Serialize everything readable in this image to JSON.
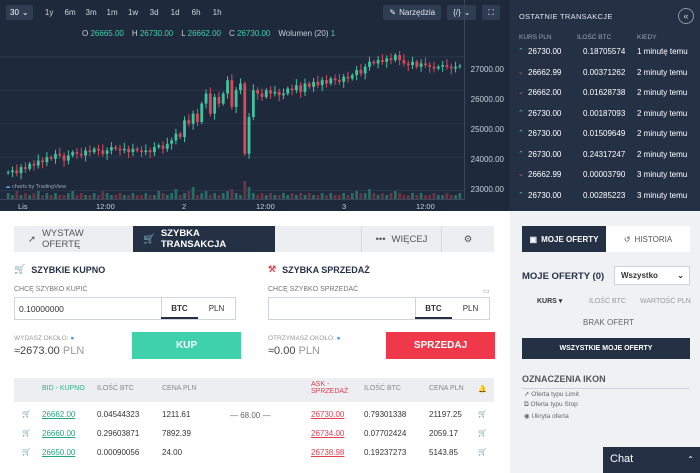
{
  "chart": {
    "interval": "30",
    "timeframes": [
      "1y",
      "6m",
      "3m",
      "1m",
      "1w",
      "3d",
      "1d",
      "6h",
      "1h"
    ],
    "tools_label": "Narzędzia",
    "ohlc": {
      "o_label": "O",
      "o": "26665.00",
      "h_label": "H",
      "h": "26730.00",
      "l_label": "L",
      "l": "26662.00",
      "c_label": "C",
      "c": "26730.00",
      "volume": "Wolumen (20)",
      "volume_value": "1"
    },
    "logo_text": "charts by TradingView"
  },
  "chart_data": {
    "type": "candlestick",
    "y_ticks": [
      "27000.00",
      "26000.00",
      "25000.00",
      "24000.00",
      "23000.00"
    ],
    "y_tick_values": [
      27000,
      26000,
      25000,
      24000,
      23000
    ],
    "x_ticks": [
      "Lis",
      "12:00",
      "2",
      "12:00",
      "3",
      "12:00"
    ],
    "ylim": [
      22750,
      27350
    ],
    "close": [
      23550,
      23600,
      23520,
      23700,
      23650,
      23800,
      23750,
      23900,
      23850,
      24000,
      23950,
      24100,
      24050,
      23900,
      24050,
      24150,
      24100,
      24050,
      24200,
      24150,
      24250,
      24200,
      24100,
      24200,
      24300,
      24250,
      24200,
      24250,
      24150,
      24250,
      24200,
      24150,
      24200,
      24150,
      24300,
      24350,
      24250,
      24400,
      24500,
      24700,
      24600,
      25100,
      25000,
      25300,
      25050,
      25600,
      25900,
      25300,
      25800,
      25600,
      25900,
      26300,
      25500,
      26000,
      26200,
      24100,
      25200,
      26000,
      25900,
      25800,
      26000,
      25900,
      25950,
      25850,
      25900,
      26050,
      26000,
      26150,
      25950,
      26200,
      26100,
      26250,
      26150,
      26300,
      26200,
      26350,
      26300,
      26250,
      26400,
      26350,
      26450,
      26600,
      26500,
      26700,
      26850,
      26800,
      26900,
      26850,
      26950,
      26900,
      27050,
      26900,
      26800,
      26750,
      26850,
      26700,
      26800,
      26750,
      26700,
      26650,
      26700,
      26750,
      26700,
      26650,
      26700,
      26730
    ],
    "volume": [
      3,
      2,
      4,
      2,
      3,
      2,
      3,
      4,
      2,
      3,
      2,
      3,
      2,
      2,
      3,
      4,
      2,
      3,
      2,
      2,
      3,
      2,
      4,
      3,
      2,
      2,
      3,
      2,
      2,
      3,
      2,
      2,
      3,
      2,
      2,
      4,
      3,
      2,
      3,
      5,
      2,
      3,
      4,
      6,
      2,
      3,
      4,
      2,
      3,
      2,
      3,
      4,
      5,
      3,
      2,
      9,
      6,
      3,
      2,
      3,
      2,
      3,
      2,
      2,
      3,
      2,
      3,
      2,
      3,
      2,
      3,
      2,
      2,
      3,
      2,
      3,
      2,
      2,
      3,
      2,
      3,
      4,
      3,
      3,
      5,
      3,
      2,
      3,
      2,
      3,
      4,
      3,
      2,
      2,
      3,
      2,
      3,
      2,
      2,
      3,
      2,
      2,
      3,
      2,
      2,
      3
    ]
  },
  "recent": {
    "title": "OSTATNIE TRANSAKCJE",
    "headers": [
      "KURS PLN",
      "ILOŚĆ BTC",
      "KIEDY"
    ],
    "rows": [
      {
        "dir": "up",
        "price": "26730.00",
        "qty": "0.18705574",
        "when": "1 minutę temu"
      },
      {
        "dir": "dn",
        "price": "26662.99",
        "qty": "0.00371262",
        "when": "2 minuty temu"
      },
      {
        "dir": "dn",
        "price": "26662.00",
        "qty": "0.01628738",
        "when": "2 minuty temu"
      },
      {
        "dir": "up",
        "price": "26730.00",
        "qty": "0.00187093",
        "when": "2 minuty temu"
      },
      {
        "dir": "up",
        "price": "26730.00",
        "qty": "0.01509649",
        "when": "2 minuty temu"
      },
      {
        "dir": "up",
        "price": "26730.00",
        "qty": "0.24317247",
        "when": "2 minuty temu"
      },
      {
        "dir": "dn",
        "price": "26662.99",
        "qty": "0.00003790",
        "when": "3 minuty temu"
      },
      {
        "dir": "up",
        "price": "26730.00",
        "qty": "0.00285223",
        "when": "3 minuty temu"
      }
    ]
  },
  "trade": {
    "tab_offer": "WYSTAW OFERTĘ",
    "tab_quick": "SZYBKA TRANSAKCJA",
    "more": "WIĘCEJ",
    "buy": {
      "title": "SZYBKIE KUPNO",
      "label": "CHCĘ SZYBKO KUPIĆ",
      "value": "0.10000000",
      "est_label": "WYDASZ OKOŁO:",
      "est_value": "≈2673.00",
      "est_unit": "PLN",
      "button": "KUP"
    },
    "sell": {
      "title": "SZYBKA SPRZEDAŻ",
      "label": "CHCĘ SZYBKO SPRZEDAĆ",
      "value": "",
      "est_label": "OTRZYMASZ OKOŁO:",
      "est_value": "≈0.00",
      "est_unit": "PLN",
      "button": "SPRZEDAJ"
    },
    "cur_btc": "BTC",
    "cur_pln": "PLN"
  },
  "orderbook": {
    "bid_header": "BID - KUPNO",
    "qty_header": "ILOŚĆ BTC",
    "price_header": "CENA PLN",
    "ask_header_1": "ASK -",
    "ask_header_2": "SPRZEDAŻ",
    "spread": "68.00",
    "bids": [
      {
        "rate": "26662.00",
        "qty": "0.04544323",
        "total": "1211.61"
      },
      {
        "rate": "26660.00",
        "qty": "0.29603871",
        "total": "7892.39"
      },
      {
        "rate": "26650.00",
        "qty": "0.00090056",
        "total": "24.00"
      }
    ],
    "asks": [
      {
        "rate": "26730.00",
        "qty": "0.79301338",
        "total": "21197.25"
      },
      {
        "rate": "26734.00",
        "qty": "0.07702424",
        "total": "2059.17"
      },
      {
        "rate": "26738.98",
        "qty": "0.19237273",
        "total": "5143.85"
      }
    ]
  },
  "offers": {
    "tab_mine": "MOJE OFERTY",
    "tab_history": "HISTORIA",
    "title": "MOJE OFERTY (0)",
    "filter": "Wszystko",
    "col_rate": "KURS",
    "col_qty": "ILOŚĆ BTC",
    "col_value": "WARTOŚĆ PLN",
    "empty": "BRAK OFERT",
    "all_button": "WSZYSTKIE MOJE OFERTY",
    "legend_title": "OZNACZENIA IKON",
    "legend": [
      "Oferta typu Limit",
      "Oferta typu Stop",
      "Ukryta oferta"
    ]
  },
  "chat": {
    "label": "Chat"
  }
}
